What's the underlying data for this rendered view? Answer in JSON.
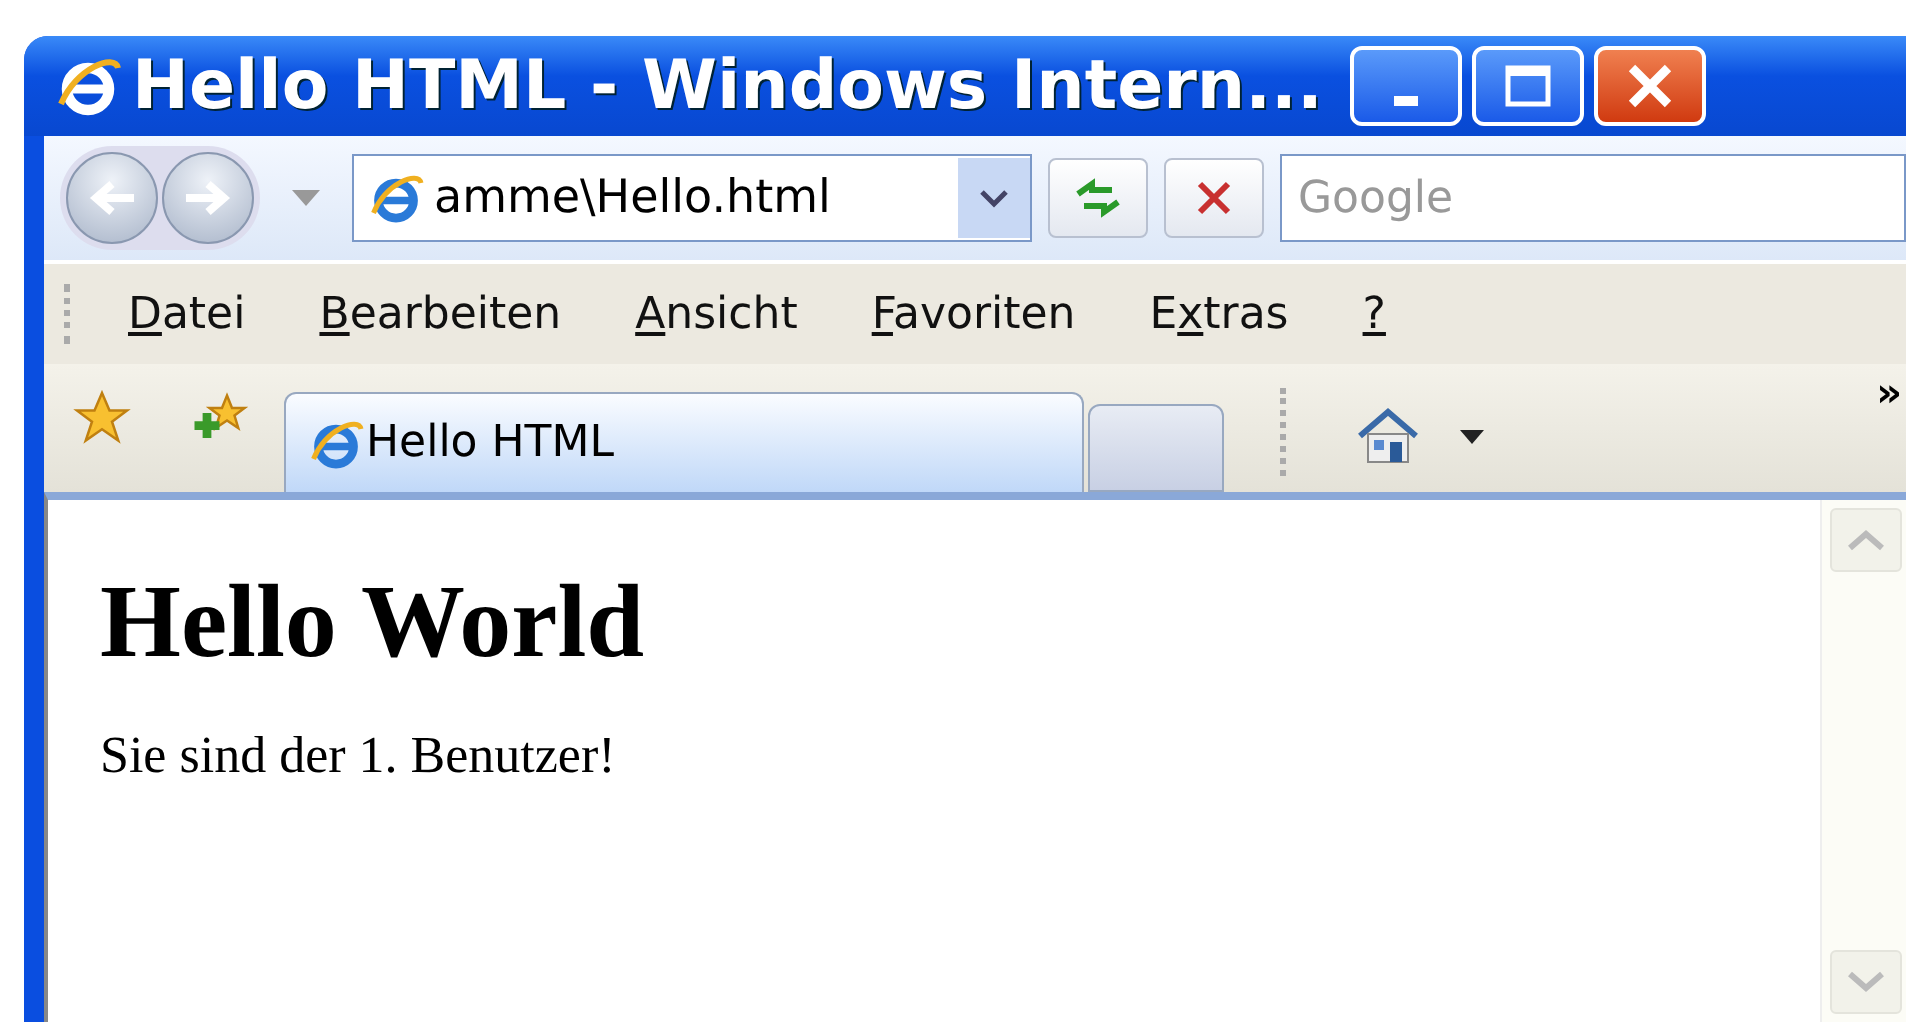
{
  "window": {
    "title": "Hello HTML - Windows Intern..."
  },
  "address": {
    "value": "amme\\Hello.html"
  },
  "search": {
    "placeholder": "Google"
  },
  "menu": [
    {
      "key": "D",
      "post": "atei"
    },
    {
      "key": "B",
      "post": "earbeiten"
    },
    {
      "key": "A",
      "post": "nsicht"
    },
    {
      "key": "F",
      "post": "avoriten"
    },
    {
      "pre": "E",
      "key": "x",
      "post": "tras"
    },
    {
      "key": "?"
    }
  ],
  "tabs": [
    {
      "label": "Hello HTML",
      "selected": true
    }
  ],
  "toolbar_overflow": "»",
  "page": {
    "heading": "Hello World",
    "text": "Sie sind der 1. Benutzer!"
  }
}
